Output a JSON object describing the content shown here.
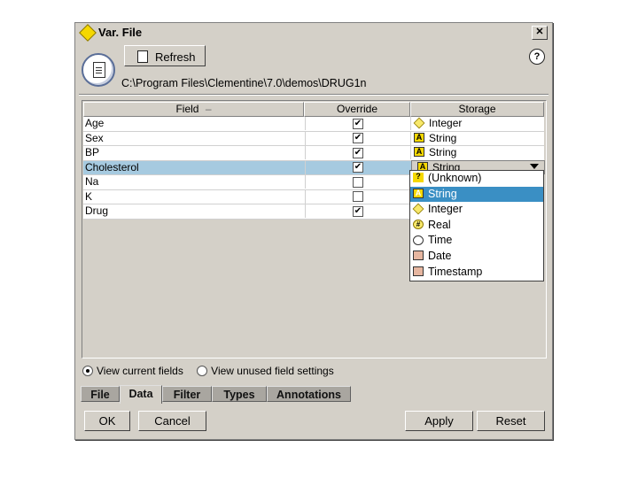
{
  "window": {
    "title": "Var. File",
    "close_label": "✕"
  },
  "toolbar": {
    "refresh_label": "Refresh",
    "help_label": "?"
  },
  "file_path": "C:\\Program Files\\Clementine\\7.0\\demos\\DRUG1n",
  "table": {
    "headers": {
      "field": "Field",
      "sort_glyph": "‒",
      "override": "Override",
      "storage": "Storage"
    },
    "rows": [
      {
        "field": "Age",
        "override": true,
        "storage": "Integer",
        "icon": "integer-icon"
      },
      {
        "field": "Sex",
        "override": true,
        "storage": "String",
        "icon": "string-icon"
      },
      {
        "field": "BP",
        "override": true,
        "storage": "String",
        "icon": "string-icon"
      },
      {
        "field": "Cholesterol",
        "override": true,
        "storage": "String",
        "icon": "string-icon"
      },
      {
        "field": "Na",
        "override": false,
        "storage": "",
        "icon": ""
      },
      {
        "field": "K",
        "override": false,
        "storage": "",
        "icon": ""
      },
      {
        "field": "Drug",
        "override": true,
        "storage": "",
        "icon": ""
      }
    ],
    "selected_row": 3
  },
  "storage_dropdown": {
    "selected": "String",
    "options": [
      {
        "label": "(Unknown)",
        "icon": "unknown-icon",
        "glyph": "?"
      },
      {
        "label": "String",
        "icon": "string-icon",
        "glyph": "A"
      },
      {
        "label": "Integer",
        "icon": "integer-icon",
        "glyph": ""
      },
      {
        "label": "Real",
        "icon": "real-icon",
        "glyph": "#"
      },
      {
        "label": "Time",
        "icon": "time-icon",
        "glyph": "◷"
      },
      {
        "label": "Date",
        "icon": "date-icon",
        "glyph": "▦"
      },
      {
        "label": "Timestamp",
        "icon": "timestamp-icon",
        "glyph": "▦"
      }
    ],
    "highlighted": 1
  },
  "view_options": {
    "current": "View current fields",
    "unused": "View unused field settings",
    "selected": "current"
  },
  "tabs": [
    {
      "label": "File",
      "active": false
    },
    {
      "label": "Data",
      "active": true
    },
    {
      "label": "Filter",
      "active": false
    },
    {
      "label": "Types",
      "active": false
    },
    {
      "label": "Annotations",
      "active": false
    }
  ],
  "buttons": {
    "ok": "OK",
    "cancel": "Cancel",
    "apply": "Apply",
    "reset": "Reset"
  },
  "colors": {
    "dialog_bg": "#d4d0c8",
    "row_selected": "#a6cae0",
    "dropdown_selected": "#3a8fc4",
    "string_icon": "#f5d800"
  }
}
